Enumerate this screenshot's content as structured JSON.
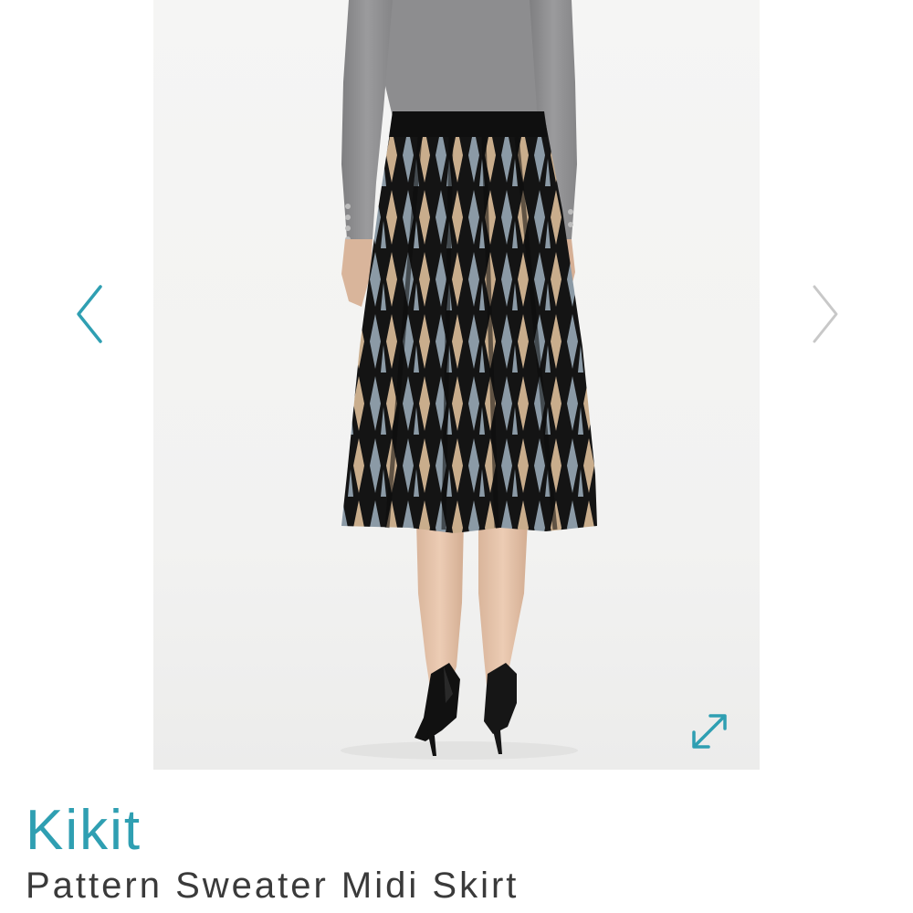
{
  "gallery": {
    "image_alt": "Pattern Sweater Midi Skirt",
    "prev_icon": "chevron-left-icon",
    "next_icon": "chevron-right-icon",
    "expand_icon": "expand-arrows-icon",
    "accent_color": "#2f9fb2",
    "inactive_arrow_color": "#c8c8c8"
  },
  "product": {
    "brand": "Kikit",
    "name": "Pattern Sweater Midi Skirt"
  }
}
